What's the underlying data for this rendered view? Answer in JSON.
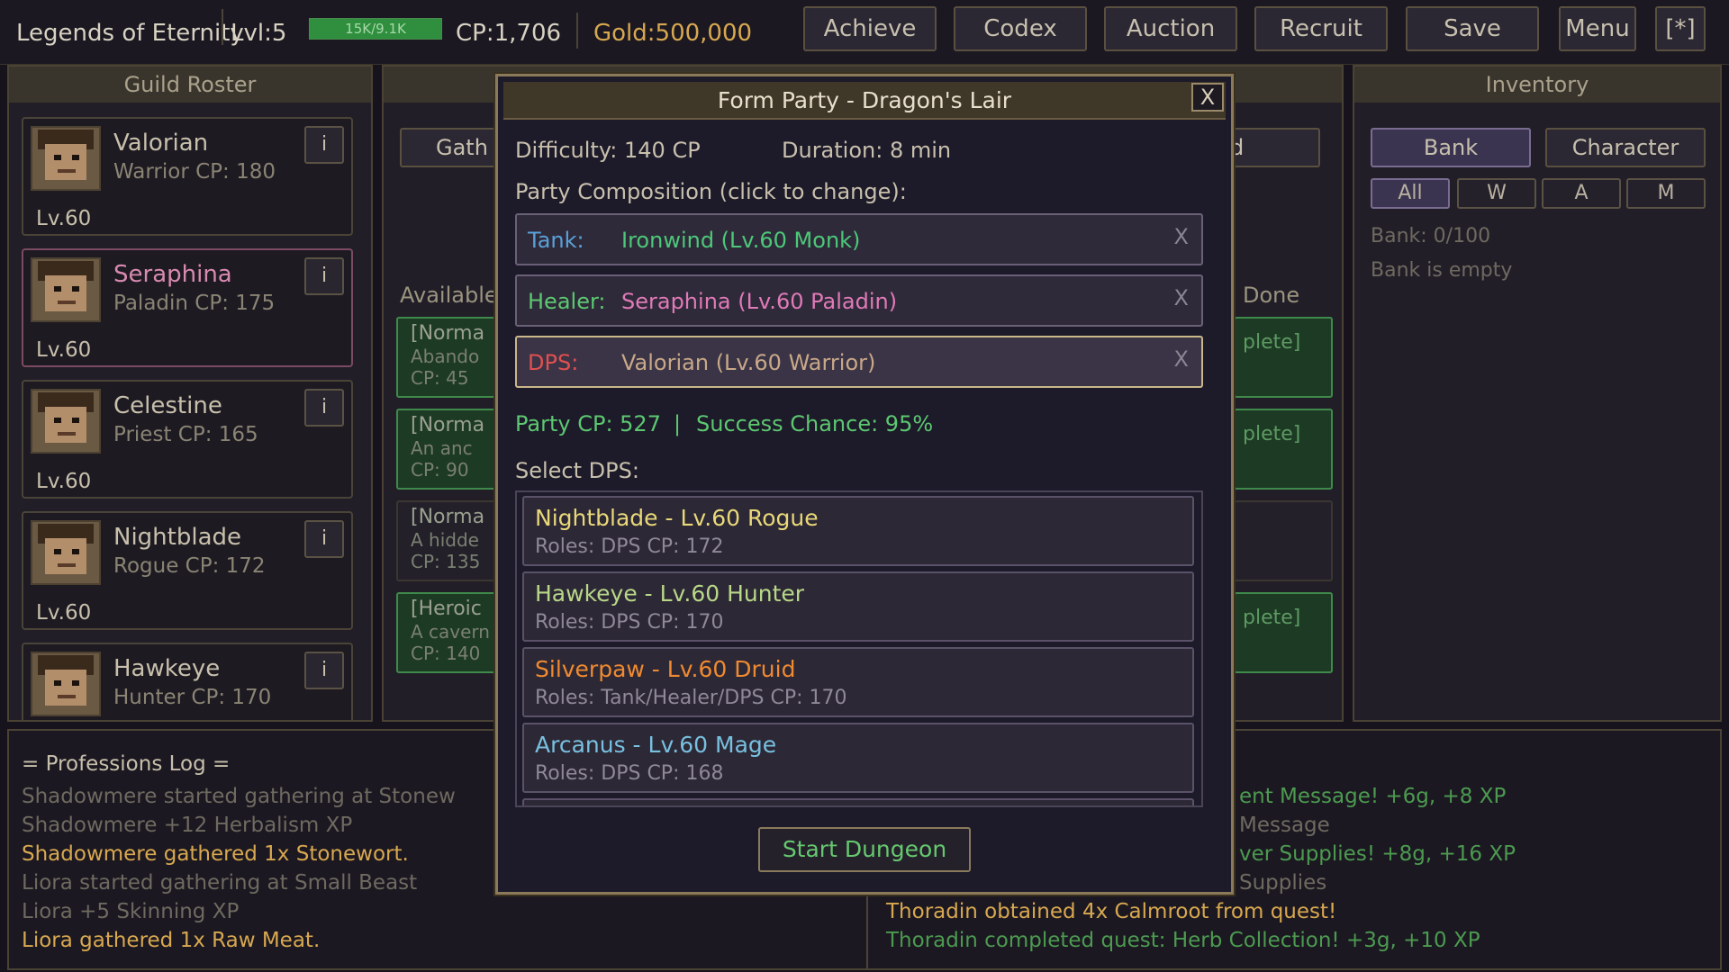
{
  "topbar": {
    "game_title": "Legends of Eternity",
    "level": "Lvl:5",
    "xp_text": "15K/9.1K",
    "xp_progress": 1.0,
    "cp": "CP:1,706",
    "gold": "Gold:500,000",
    "buttons": [
      "Achieve",
      "Codex",
      "Auction",
      "Recruit",
      "Save",
      "Menu",
      "[*]"
    ]
  },
  "roster": {
    "title": "Guild Roster",
    "members": [
      {
        "name": "Valorian",
        "info": "Warrior   CP: 180",
        "level": "Lv.60",
        "name_color": "#c8c0ac"
      },
      {
        "name": "Seraphina",
        "info": "Paladin   CP: 175",
        "level": "Lv.60",
        "name_color": "#d88ab0"
      },
      {
        "name": "Celestine",
        "info": "Priest   CP: 165",
        "level": "Lv.60",
        "name_color": "#c8c0ac"
      },
      {
        "name": "Nightblade",
        "info": "Rogue   CP: 172",
        "level": "Lv.60",
        "name_color": "#c8c0ac"
      },
      {
        "name": "Hawkeye",
        "info": "Hunter   CP: 170",
        "level": "",
        "name_color": "#c8c0ac"
      }
    ],
    "info_button": "i"
  },
  "quests": {
    "tab_left": "Gath",
    "tab_right": "d",
    "available_label": "Available",
    "done_label": "Done",
    "cards": [
      {
        "l1": "[Norma",
        "l2": "Abando",
        "l3": "CP: 45"
      },
      {
        "l1": "[Norma",
        "l2": "An anc",
        "l3": "CP: 90"
      },
      {
        "l1": "[Norma",
        "l2": "A hidde",
        "l3": "CP: 135"
      },
      {
        "l1": "[Heroic",
        "l2": "A cavern",
        "l3": "CP: 140"
      }
    ],
    "right_labels": [
      "plete]",
      "plete]",
      "plete]"
    ]
  },
  "inventory": {
    "title": "Inventory",
    "tabs": [
      "Bank",
      "Character"
    ],
    "filters": [
      "All",
      "W",
      "A",
      "M"
    ],
    "bank_count": "Bank: 0/100",
    "bank_empty": "Bank is empty"
  },
  "professions_log": {
    "title": "= Professions Log =",
    "lines": [
      {
        "text": "Shadowmere started gathering at Stonew",
        "color": "#6e6a60"
      },
      {
        "text": "Shadowmere +12 Herbalism XP",
        "color": "#6e6a60"
      },
      {
        "text": "Shadowmere gathered 1x Stonewort.",
        "color": "#d8a850"
      },
      {
        "text": "Liora started gathering at Small Beast",
        "color": "#6e6a60"
      },
      {
        "text": "Liora +5 Skinning XP",
        "color": "#6e6a60"
      },
      {
        "text": "Liora gathered 1x Raw Meat.",
        "color": "#d8a850"
      }
    ]
  },
  "quest_log": {
    "lines": [
      {
        "text": "ent Message! +6g, +8 XP",
        "color": "#4c9a50"
      },
      {
        "text": "Message",
        "color": "#6e6a60"
      },
      {
        "text": "ver Supplies! +8g, +16 XP",
        "color": "#4c9a50"
      },
      {
        "text": "Supplies",
        "color": "#6e6a60"
      },
      {
        "text": "Thoradin obtained 4x Calmroot from quest!",
        "color": "#d8a850"
      },
      {
        "text": "Thoradin completed quest: Herb Collection! +3g, +10 XP",
        "color": "#4c9a50"
      }
    ]
  },
  "modal": {
    "title": "Form Party - Dragon's Lair",
    "close": "X",
    "difficulty": "Difficulty: 140 CP",
    "duration": "Duration: 8 min",
    "composition_label": "Party Composition (click to change):",
    "slots": [
      {
        "role": "Tank:",
        "value": "Ironwind (Lv.60 Monk)",
        "role_color": "#5aa0d8",
        "value_color": "#4cc878"
      },
      {
        "role": "Healer:",
        "value": "Seraphina (Lv.60 Paladin)",
        "role_color": "#5cc870",
        "value_color": "#e07ab8"
      },
      {
        "role": "DPS:",
        "value": "Valorian (Lv.60 Warrior)",
        "role_color": "#e05050",
        "value_color": "#c8a888"
      }
    ],
    "remove": "X",
    "party_cp": "Party CP: 527",
    "separator": "|",
    "success": "Success Chance: 95%",
    "select_label": "Select DPS:",
    "candidates": [
      {
        "name": "Nightblade - Lv.60 Rogue",
        "roles": "Roles: DPS   CP: 172",
        "color": "#e8d878"
      },
      {
        "name": "Hawkeye - Lv.60 Hunter",
        "roles": "Roles: DPS   CP: 170",
        "color": "#b8d888"
      },
      {
        "name": "Silverpaw - Lv.60 Druid",
        "roles": "Roles: Tank/Healer/DPS   CP: 170",
        "color": "#f08a30"
      },
      {
        "name": "Arcanus - Lv.60 Mage",
        "roles": "Roles: DPS   CP: 168",
        "color": "#78c0e0"
      }
    ],
    "start_button": "Start Dungeon"
  }
}
